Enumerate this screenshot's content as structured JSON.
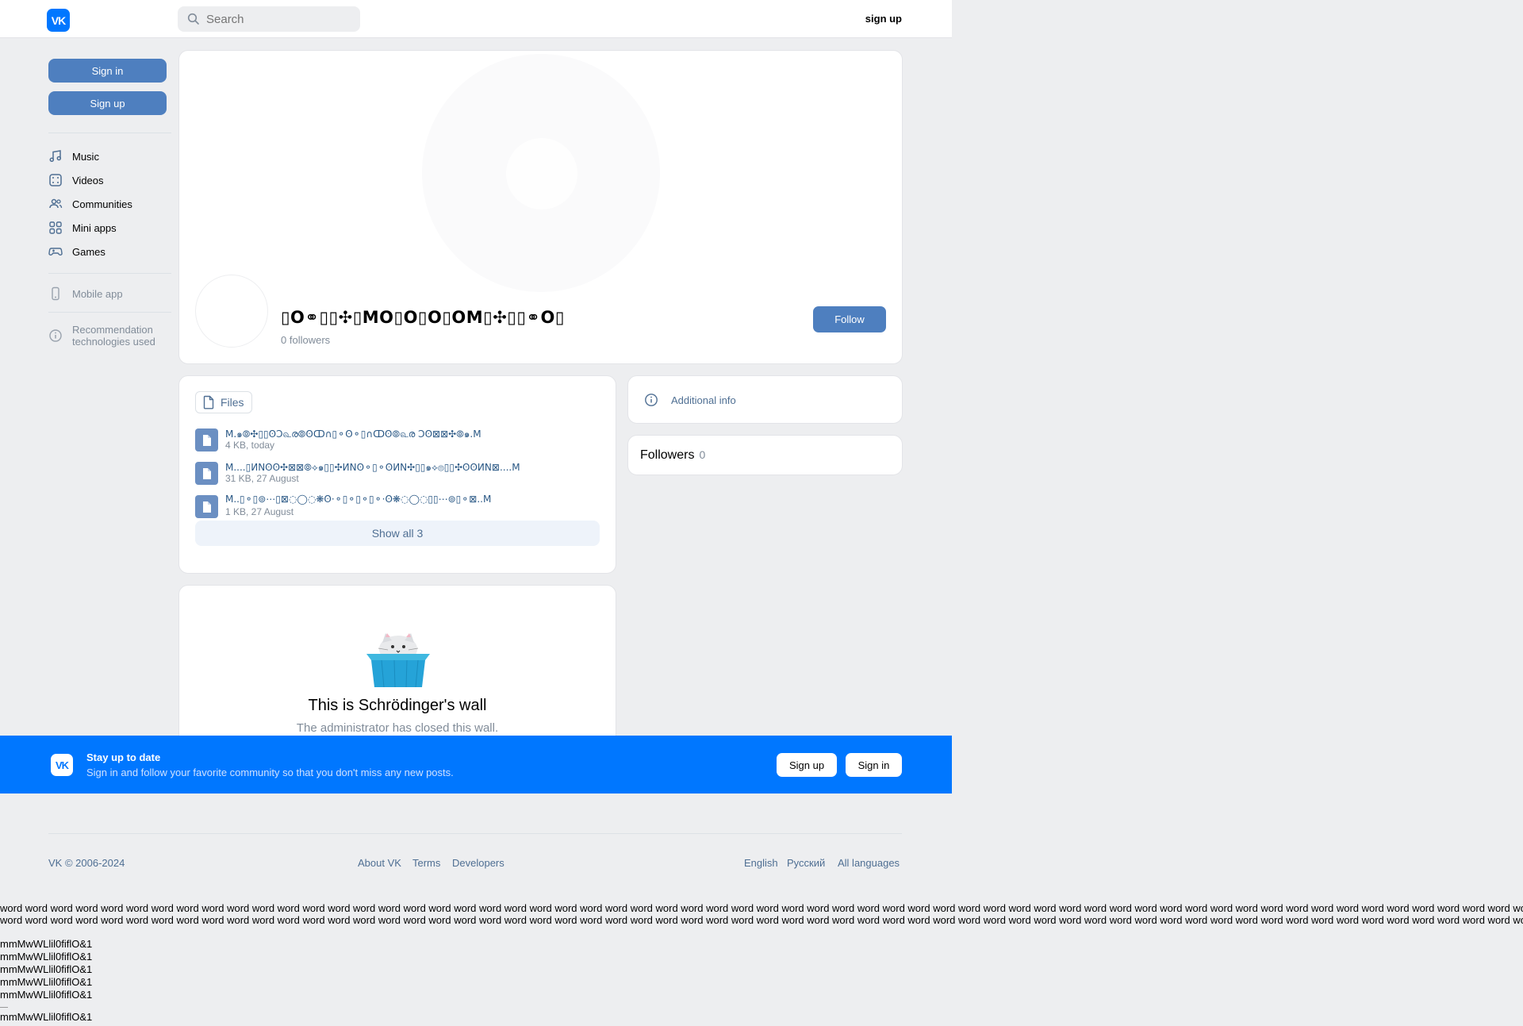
{
  "header": {
    "logo": "VK",
    "search_placeholder": "Search",
    "signup_label": "sign up"
  },
  "sidebar": {
    "signin_label": "Sign in",
    "signup_label": "Sign up",
    "items": [
      {
        "label": "Music",
        "icon": "music-icon"
      },
      {
        "label": "Videos",
        "icon": "videos-icon"
      },
      {
        "label": "Communities",
        "icon": "communities-icon"
      },
      {
        "label": "Mini apps",
        "icon": "mini-apps-icon"
      },
      {
        "label": "Games",
        "icon": "games-icon"
      }
    ],
    "mobile_app": "Mobile app",
    "recommendation_line1": "Recommendation",
    "recommendation_line2": "technologies used"
  },
  "community": {
    "name": "▯O⚭▯▯✣▯MO▯O▯O▯OM▯✣▯▯⚭O▯",
    "followers_count": "0",
    "followers_label": "followers",
    "follow_label": "Follow"
  },
  "files": {
    "tab_label": "Files",
    "items": [
      {
        "name": "M.๑⦾✣▯▯ʘƆ௳ര⦾ʘↀ∩▯⚬ʘ⚬▯∩ↀʘ⦾௳ര Ɔʘ⊠⊠✣⦾๑.M",
        "meta": "4 KB, today"
      },
      {
        "name": "M....▯ИNʘʘ✣⊠⊠⦾⟡๑▯▯✣ИNʘ⚬▯⚬ʘИN✣▯▯๑⟡⦾▯▯✣ʘʘИN⊠....M",
        "meta": "31 KB, 27 August"
      },
      {
        "name": "M..▯⚬▯⊚⋯▯⊠◌◯◌❋ʘ·⚬▯⚬▯⚬▯⚬·ʘ❋◌◯◌▯▯⋯⊚▯⚬⊠..M",
        "meta": "1 KB, 27 August"
      }
    ],
    "show_all_label": "Show all 3"
  },
  "wall": {
    "title": "This is Schrödinger's wall",
    "subtitle": "The administrator has closed this wall."
  },
  "right": {
    "additional_info": "Additional info",
    "followers_title": "Followers",
    "followers_count": "0"
  },
  "banner": {
    "title": "Stay up to date",
    "subtitle": "Sign in and follow your favorite community so that you don't miss any new posts.",
    "signup_label": "Sign up",
    "signin_label": "Sign in"
  },
  "footer": {
    "copyright": "VK © 2006-2024",
    "about": "About VK",
    "terms": "Terms",
    "developers": "Developers",
    "lang_en": "English",
    "lang_ru": "Русский",
    "all_languages": "All languages"
  },
  "extra": {
    "word_line": "word word word word word word word word word word word word word word word word word word word word word word word word word word word word word word word word word word word word word word word word word word word word word word word word word word word word word word word word word word word word word word word word word word word word word word word word word word word word word word word word word word word word word word word word word word word word word word word word word word word word word word word word word word word word word word word word word",
    "mm_line": "mmMwWLlil0fiflO&1"
  },
  "colors": {
    "brand": "#0077ff",
    "button": "#4e7fbf",
    "link": "#4f6f93",
    "background": "#edeef0"
  }
}
